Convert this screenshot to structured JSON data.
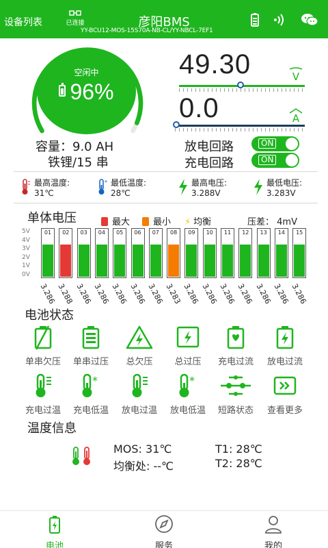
{
  "header": {
    "device_list": "设备列表",
    "connection_status": "已连接",
    "title": "彦阳BMS",
    "device_id": "YY-BCU12-MOS-15S70A-NB-CL/YY-NBCL-7EF1",
    "icons": [
      "connection-icon",
      "battery-icon",
      "signal-icon",
      "wechat-icon"
    ]
  },
  "soc": {
    "state": "空闲中",
    "percent": "96%",
    "level": 0.96
  },
  "capacity": {
    "line1": "容量：9.0 AH",
    "line2": "铁锂/15 串"
  },
  "voltage": {
    "value": "49.30",
    "unit": "V",
    "slider_fraction": 0.49
  },
  "current": {
    "value": "0.0",
    "unit": "A",
    "slider_fraction": 0.0
  },
  "circuits": [
    {
      "label": "放电回路",
      "state": "ON"
    },
    {
      "label": "充电回路",
      "state": "ON"
    }
  ],
  "stats": [
    {
      "label": "最高温度:",
      "value": "31℃",
      "icon": "thermometer-hot-icon"
    },
    {
      "label": "最低温度:",
      "value": "28℃",
      "icon": "thermometer-cold-icon"
    },
    {
      "label": "最高电压:",
      "value": "3.288V",
      "icon": "bolt-icon"
    },
    {
      "label": "最低电压:",
      "value": "3.283V",
      "icon": "bolt-icon"
    }
  ],
  "cell_section": {
    "title": "单体电压",
    "legend": [
      {
        "label": "最大",
        "color": "#e53935"
      },
      {
        "label": "最小",
        "color": "#f57c00"
      },
      {
        "label": "均衡",
        "color": "#f5c400"
      }
    ],
    "pressure_diff": "压差：  4mV",
    "y_ticks": [
      "5V",
      "4V",
      "3V",
      "2V",
      "1V",
      "0V"
    ]
  },
  "chart_data": {
    "type": "bar",
    "title": "单体电压",
    "categories": [
      "01",
      "02",
      "03",
      "04",
      "05",
      "06",
      "07",
      "08",
      "09",
      "10",
      "11",
      "12",
      "13",
      "14",
      "15"
    ],
    "values": [
      3.286,
      3.288,
      3.286,
      3.286,
      3.286,
      3.286,
      3.286,
      3.283,
      3.286,
      3.286,
      3.286,
      3.286,
      3.286,
      3.286,
      3.286
    ],
    "value_labels": [
      "3.286",
      "3.288",
      "3.286",
      "3.286",
      "3.286",
      "3.286",
      "3.286",
      "3.283",
      "3.286",
      "3.286",
      "3.286",
      "3.286",
      "3.286",
      "3.286",
      "3.286"
    ],
    "highlight": {
      "max_index": 1,
      "min_index": 7
    },
    "ylim": [
      0,
      5
    ],
    "colors": {
      "normal": "#1fb51f",
      "max": "#e53935",
      "min": "#f57c00"
    }
  },
  "battery_status": {
    "title": "电池状态",
    "items": [
      {
        "label": "单串欠压",
        "icon": "cell-undervoltage-icon"
      },
      {
        "label": "单串过压",
        "icon": "cell-overvoltage-icon"
      },
      {
        "label": "总欠压",
        "icon": "total-undervoltage-icon"
      },
      {
        "label": "总过压",
        "icon": "total-overvoltage-icon"
      },
      {
        "label": "充电过流",
        "icon": "charge-overcurrent-icon"
      },
      {
        "label": "放电过流",
        "icon": "discharge-overcurrent-icon"
      },
      {
        "label": "充电过温",
        "icon": "charge-overtemp-icon"
      },
      {
        "label": "充电低温",
        "icon": "charge-lowtemp-icon"
      },
      {
        "label": "放电过温",
        "icon": "discharge-overtemp-icon"
      },
      {
        "label": "放电低温",
        "icon": "discharge-lowtemp-icon"
      },
      {
        "label": "短路状态",
        "icon": "short-circuit-icon"
      },
      {
        "label": "查看更多",
        "icon": "view-more-icon"
      }
    ]
  },
  "temperature": {
    "title": "温度信息",
    "mos": "MOS: 31℃",
    "t1": "T1: 28℃",
    "balance": "均衡处: --℃",
    "t2": "T2: 28℃"
  },
  "bottom_nav": [
    {
      "label": "电池",
      "active": true,
      "icon": "battery-tab-icon"
    },
    {
      "label": "服务",
      "active": false,
      "icon": "compass-icon"
    },
    {
      "label": "我的",
      "active": false,
      "icon": "user-icon"
    }
  ],
  "colors": {
    "accent": "#1fb51f",
    "text": "#222222"
  }
}
